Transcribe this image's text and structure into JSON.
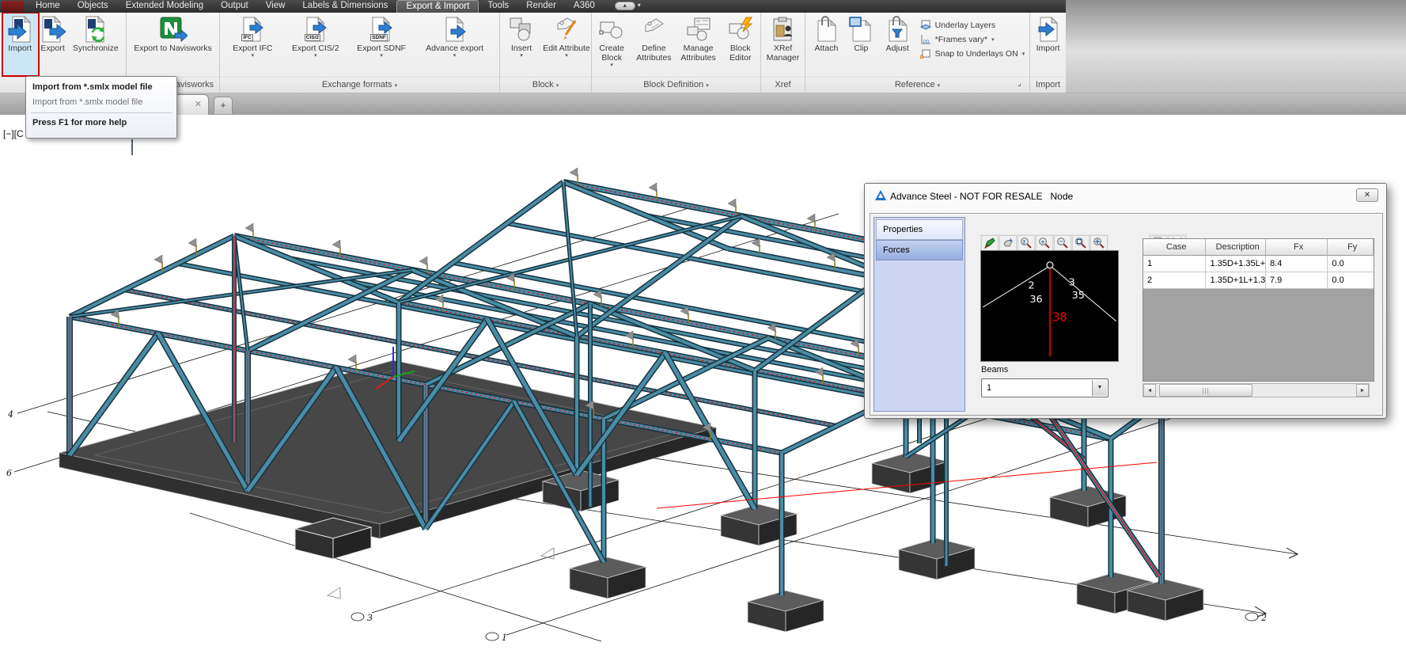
{
  "menu": {
    "tabs": [
      {
        "label": "Home"
      },
      {
        "label": "Objects"
      },
      {
        "label": "Extended Modeling"
      },
      {
        "label": "Output"
      },
      {
        "label": "View"
      },
      {
        "label": "Labels & Dimensions"
      },
      {
        "label": "Export & Import"
      },
      {
        "label": "Tools"
      },
      {
        "label": "Render"
      },
      {
        "label": "A360"
      }
    ]
  },
  "ribbon": {
    "groups": [
      {
        "label": "",
        "buttons": [
          {
            "label": "Import"
          },
          {
            "label": "Export"
          },
          {
            "label": "Synchronize"
          }
        ]
      },
      {
        "label": "Export to Navisworks",
        "buttons": [
          {
            "label": "Export to Navisworks"
          }
        ]
      },
      {
        "label": "Exchange formats",
        "buttons": [
          {
            "label": "Export IFC",
            "icon_text": "IFC"
          },
          {
            "label": "Export CIS/2",
            "icon_text": "CIS/2"
          },
          {
            "label": "Export SDNF",
            "icon_text": "SDNF"
          },
          {
            "label": "Advance export",
            "icon_text": ""
          }
        ]
      },
      {
        "label": "Block",
        "buttons": [
          {
            "label": "Insert"
          },
          {
            "label": "Edit Attribute"
          }
        ]
      },
      {
        "label": "Block Definition",
        "buttons": [
          {
            "label": "Create Block"
          },
          {
            "label": "Define Attributes"
          },
          {
            "label": "Manage Attributes"
          },
          {
            "label": "Block Editor"
          }
        ]
      },
      {
        "label": "Xref",
        "buttons": [
          {
            "label": "XRef Manager"
          }
        ]
      },
      {
        "label": "Reference",
        "buttons": [
          {
            "label": "Attach"
          },
          {
            "label": "Clip"
          },
          {
            "label": "Adjust"
          }
        ],
        "rows": [
          {
            "label": "Underlay Layers"
          },
          {
            "label": "*Frames vary*"
          },
          {
            "label": "Snap to Underlays ON"
          }
        ]
      },
      {
        "label": "Import",
        "buttons": [
          {
            "label": "Import"
          }
        ]
      }
    ]
  },
  "tooltip": {
    "title": "Import from *.smlx model file",
    "description": "Import from *.smlx model file",
    "footer": "Press F1 for more help"
  },
  "viewport": {
    "controls": "[−][C"
  },
  "dialog": {
    "title": "Advance Steel - NOT FOR RESALE   Node",
    "nav": [
      {
        "label": "Properties"
      },
      {
        "label": "Forces"
      }
    ],
    "preview": {
      "left_num": "2",
      "left_beam": "36",
      "right_num": "3",
      "right_beam": "35",
      "vertical_beam": "38"
    },
    "beams_label": "Beams",
    "beam_value": "1",
    "table": {
      "headers": [
        "Case",
        "Description",
        "Fx",
        "Fy"
      ],
      "rows": [
        [
          "1",
          "1.35D+1.35L+",
          "8.4",
          "0.0"
        ],
        [
          "2",
          "1.35D+1L+1.3",
          "7.9",
          "0.0"
        ]
      ]
    }
  },
  "canvas": {
    "axis_labels": [
      "4",
      "6",
      "3",
      "1",
      "2"
    ]
  },
  "icons": {
    "caret": "▾",
    "combo_caret": "▼",
    "close": "✕",
    "plus": "+",
    "collapse": "▲",
    "scroll_left": "◄",
    "scroll_right": "►",
    "launcher": "⌟",
    "thumb_grip": "|||"
  },
  "colors": {
    "steel": "#4a8ca4",
    "steel_dark": "#16323e",
    "selection_red": "#ff0000",
    "highlight": "#cde6f7"
  }
}
